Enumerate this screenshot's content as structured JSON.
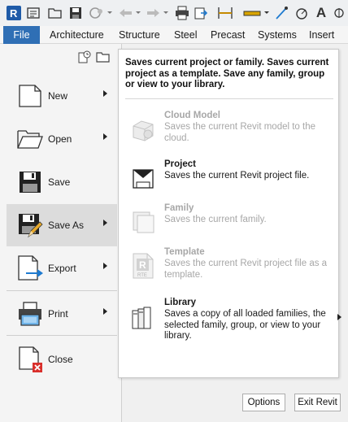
{
  "ribbon": {
    "tabs": [
      "File",
      "Architecture",
      "Structure",
      "Steel",
      "Precast",
      "Systems",
      "Insert"
    ]
  },
  "quick_access": {
    "icons": [
      "revit-logo-icon",
      "info-center-icon",
      "open-icon",
      "save-icon",
      "sync-icon",
      "undo-icon",
      "redo-icon",
      "print-icon",
      "export-icon",
      "measure-icon",
      "dimension-icon",
      "tag-icon",
      "text-icon"
    ],
    "logo_letter": "R",
    "text_tool": "A"
  },
  "app_menu": {
    "items": [
      {
        "label": "New",
        "icon": "new-file-icon",
        "has_submenu": true
      },
      {
        "label": "Open",
        "icon": "open-folder-icon",
        "has_submenu": true
      },
      {
        "label": "Save",
        "icon": "floppy-icon",
        "has_submenu": false
      },
      {
        "label": "Save As",
        "icon": "save-as-icon",
        "has_submenu": true
      },
      {
        "label": "Export",
        "icon": "export-arrow-icon",
        "has_submenu": true
      },
      {
        "label": "Print",
        "icon": "printer-icon",
        "has_submenu": true
      },
      {
        "label": "Close",
        "icon": "close-file-icon",
        "has_submenu": false
      }
    ],
    "highlighted": "Save As"
  },
  "submenu": {
    "description": "Saves current project or family. Saves current project as a template. Save any family, group or view to your library.",
    "items": [
      {
        "title": "Cloud Model",
        "desc": "Saves the current Revit model to the cloud.",
        "enabled": false,
        "icon": "cloud-model-icon"
      },
      {
        "title": "Project",
        "desc": "Saves the current Revit project file.",
        "enabled": true,
        "icon": "project-icon"
      },
      {
        "title": "Family",
        "desc": "Saves the current family.",
        "enabled": false,
        "icon": "family-icon"
      },
      {
        "title": "Template",
        "desc": "Saves the current Revit project file as a template.",
        "enabled": false,
        "icon": "template-icon",
        "badge": "R",
        "badge_sub": "RTE"
      },
      {
        "title": "Library",
        "desc": "Saves a copy of all loaded families, the selected family, group, or view to your library.",
        "enabled": true,
        "icon": "library-icon",
        "has_submenu": true
      }
    ]
  },
  "footer": {
    "options_label": "Options",
    "exit_label": "Exit Revit"
  },
  "colors": {
    "file_tab": "#2f6fb5",
    "highlight": "#dcdcdc",
    "disabled_text": "#a7a7a7",
    "export_arrow": "#1f7bd0",
    "close_x": "#d9302c"
  }
}
